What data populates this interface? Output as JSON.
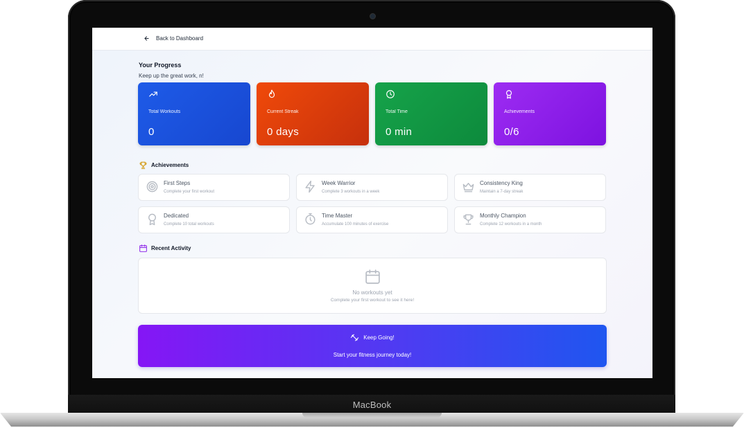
{
  "device": {
    "brand": "MacBook"
  },
  "header": {
    "back_label": "Back to Dashboard"
  },
  "progress": {
    "title": "Your Progress",
    "subtitle": "Keep up the great work, n!"
  },
  "stats": [
    {
      "label": "Total Workouts",
      "value": "0",
      "icon": "trending-up-icon",
      "color": "#1e5be8"
    },
    {
      "label": "Current Streak",
      "value": "0 days",
      "icon": "flame-icon",
      "color": "#f04a0a"
    },
    {
      "label": "Total Time",
      "value": "0 min",
      "icon": "clock-icon",
      "color": "#16a34a"
    },
    {
      "label": "Achievements",
      "value": "0/6",
      "icon": "award-icon",
      "color": "#9d2cf2"
    }
  ],
  "achievements": {
    "title": "Achievements",
    "items": [
      {
        "name": "First Steps",
        "desc": "Complete your first workout",
        "icon": "target-icon"
      },
      {
        "name": "Week Warrior",
        "desc": "Complete 3 workouts in a week",
        "icon": "lightning-icon"
      },
      {
        "name": "Consistency King",
        "desc": "Maintain a 7-day streak",
        "icon": "crown-icon"
      },
      {
        "name": "Dedicated",
        "desc": "Complete 10 total workouts",
        "icon": "medal-icon"
      },
      {
        "name": "Time Master",
        "desc": "Accumulate 100 minutes of exercise",
        "icon": "stopwatch-icon"
      },
      {
        "name": "Monthly Champion",
        "desc": "Complete 12 workouts in a month",
        "icon": "trophy-icon"
      }
    ]
  },
  "activity": {
    "title": "Recent Activity",
    "empty_title": "No workouts yet",
    "empty_sub": "Complete your first workout to see it here!"
  },
  "cta": {
    "title": "Keep Going!",
    "subtitle": "Start your fitness journey today!",
    "icon": "dumbbell-icon"
  }
}
